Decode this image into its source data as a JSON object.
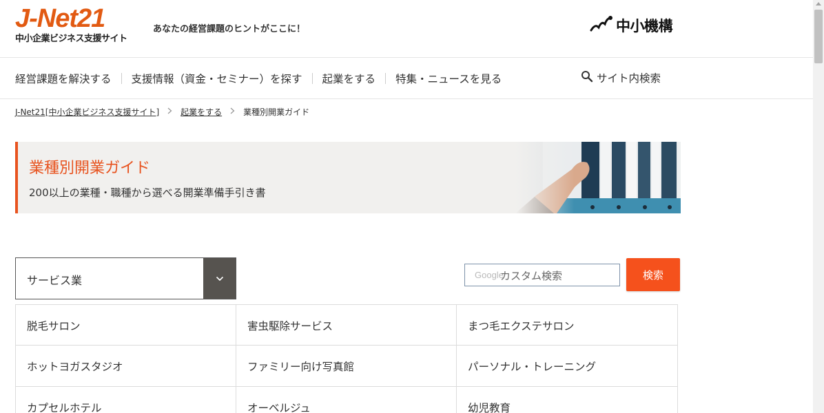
{
  "header": {
    "logo_main": "J-Net21",
    "logo_sub": "中小企業ビジネス支援サイト",
    "tagline": "あなたの経営課題のヒントがここに！",
    "org_name": "中小機構"
  },
  "nav": {
    "items": [
      {
        "label": "経営課題を解決する"
      },
      {
        "label": "支援情報（資金・セミナー）を探す"
      },
      {
        "label": "起業をする"
      },
      {
        "label": "特集・ニュースを見る"
      }
    ],
    "site_search_label": "サイト内検索"
  },
  "breadcrumb": {
    "items": [
      {
        "label": "J-Net21[中小企業ビジネス支援サイト]"
      },
      {
        "label": "起業をする"
      },
      {
        "label": "業種別開業ガイド"
      }
    ]
  },
  "banner": {
    "title": "業種別開業ガイド",
    "subtitle": "200以上の業種・職種から選べる開業準備手引き書"
  },
  "category_select": {
    "selected": "サービス業"
  },
  "search": {
    "google_watermark": "Google",
    "placeholder": "カスタム検索",
    "button_label": "検索"
  },
  "industries": [
    {
      "label": "脱毛サロン"
    },
    {
      "label": "害虫駆除サービス"
    },
    {
      "label": "まつ毛エクステサロン"
    },
    {
      "label": "ホットヨガスタジオ"
    },
    {
      "label": "ファミリー向け写真館"
    },
    {
      "label": "パーソナル・トレーニング"
    },
    {
      "label": "カプセルホテル"
    },
    {
      "label": "オーベルジュ"
    },
    {
      "label": "幼児教育"
    }
  ],
  "colors": {
    "accent": "#e8531f",
    "search_button": "#f5511c",
    "select_button": "#56534f",
    "banner_bg": "#f1f0ee"
  }
}
